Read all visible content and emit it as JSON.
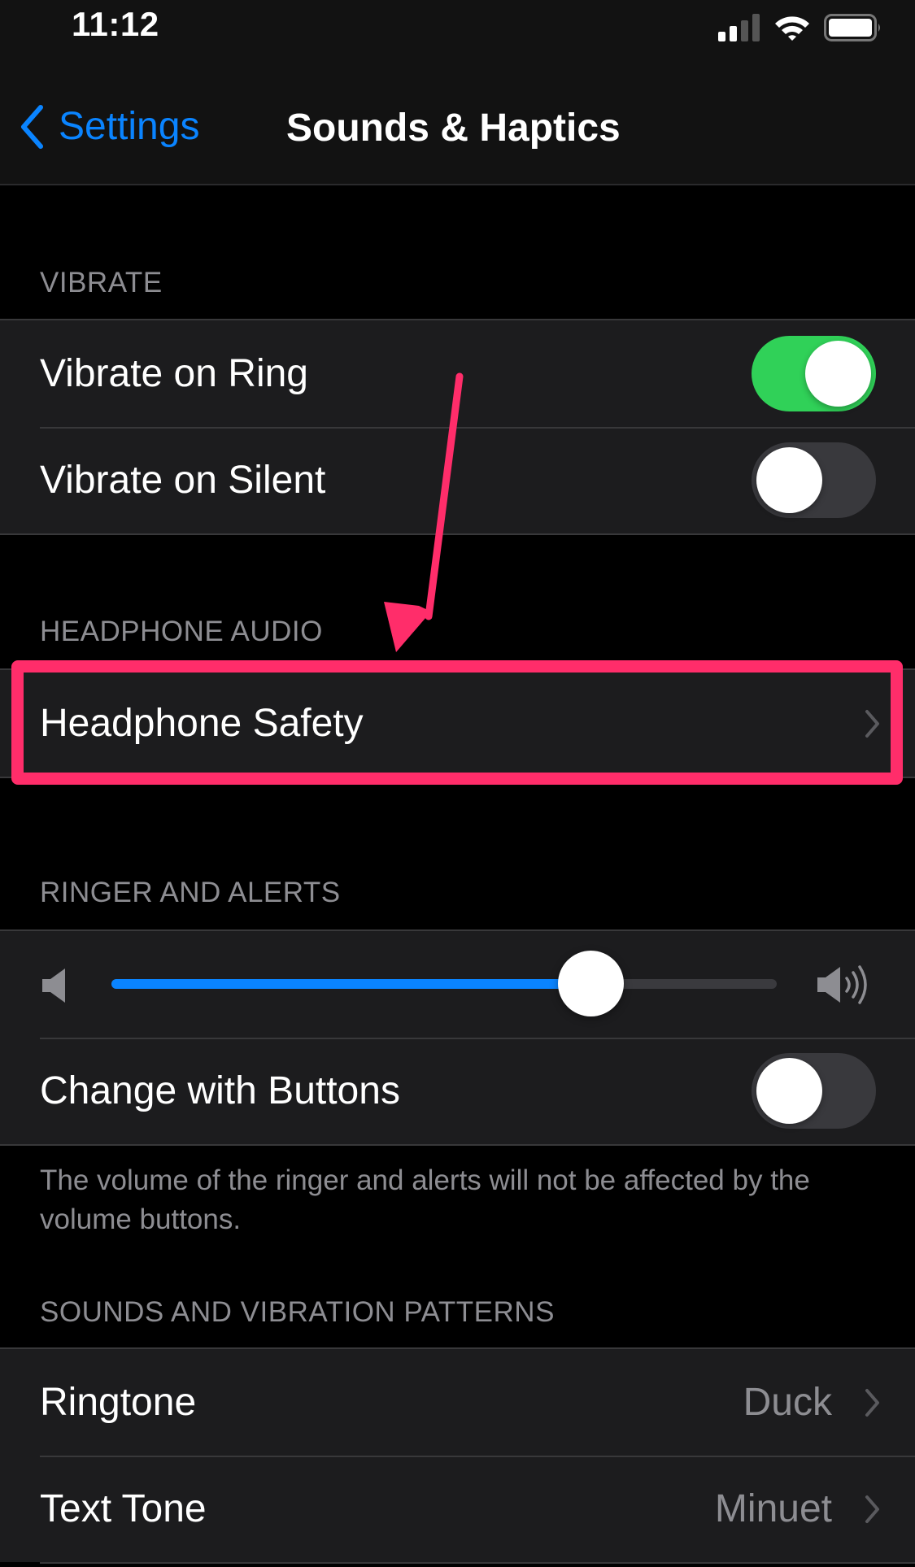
{
  "status_bar": {
    "time": "11:12",
    "icons": [
      "cellular-signal-icon",
      "wifi-icon",
      "battery-icon"
    ],
    "signal_bars_active": 2,
    "signal_bars_total": 4
  },
  "nav": {
    "back_label": "Settings",
    "back_icon": "chevron-left-icon",
    "title": "Sounds & Haptics"
  },
  "sections": {
    "vibrate": {
      "header": "VIBRATE",
      "rows": [
        {
          "label": "Vibrate on Ring",
          "toggle": true
        },
        {
          "label": "Vibrate on Silent",
          "toggle": false
        }
      ]
    },
    "headphone_audio": {
      "header": "HEADPHONE AUDIO",
      "rows": [
        {
          "label": "Headphone Safety",
          "chevron": true
        }
      ]
    },
    "ringer_alerts": {
      "header": "RINGER AND ALERTS",
      "volume": {
        "value": 0.72,
        "min_icon": "speaker-icon",
        "max_icon": "speaker-wave-icon"
      },
      "rows": [
        {
          "label": "Change with Buttons",
          "toggle": false
        }
      ],
      "footer": "The volume of the ringer and alerts will not be affected by the volume buttons."
    },
    "sounds_patterns": {
      "header": "SOUNDS AND VIBRATION PATTERNS",
      "rows": [
        {
          "label": "Ringtone",
          "value": "Duck",
          "chevron": true
        },
        {
          "label": "Text Tone",
          "value": "Minuet",
          "chevron": true
        }
      ]
    }
  },
  "annotation": {
    "highlight_target": "Headphone Safety",
    "color": "#ff2d6a"
  },
  "colors": {
    "accent": "#0a84ff",
    "toggle_on": "#30d158",
    "toggle_off": "#39393d",
    "cell_bg": "#1c1c1e",
    "secondary_text": "#8d8d92"
  }
}
